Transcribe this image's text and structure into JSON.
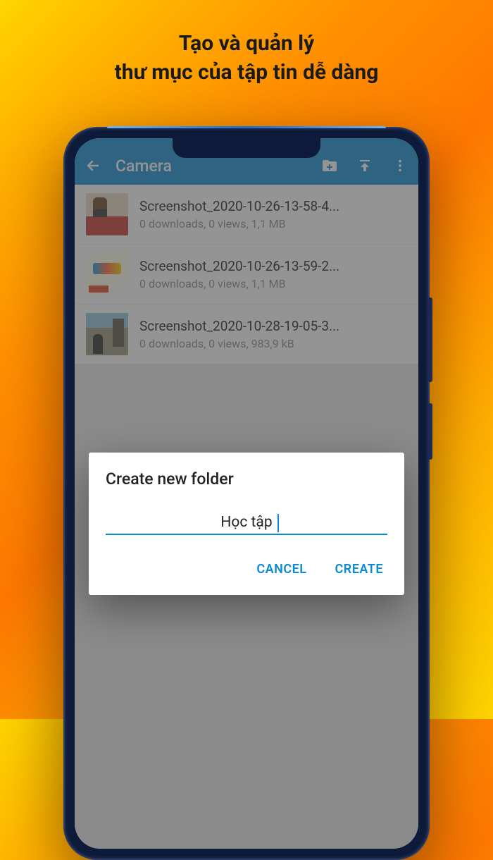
{
  "promo": {
    "line1": "Tạo và quản lý",
    "line2": "thư mục của tập tin dễ dàng"
  },
  "appbar": {
    "title": "Camera"
  },
  "files": [
    {
      "name": "Screenshot_2020-10-26-13-58-4...",
      "meta": "0 downloads, 0 views, 1,1 MB"
    },
    {
      "name": "Screenshot_2020-10-26-13-59-2...",
      "meta": "0 downloads, 0 views, 1,1 MB"
    },
    {
      "name": "Screenshot_2020-10-28-19-05-3...",
      "meta": "0 downloads, 0 views, 983,9 kB"
    }
  ],
  "dialog": {
    "title": "Create new folder",
    "input_value": "Học tập",
    "cancel": "CANCEL",
    "create": "CREATE"
  }
}
